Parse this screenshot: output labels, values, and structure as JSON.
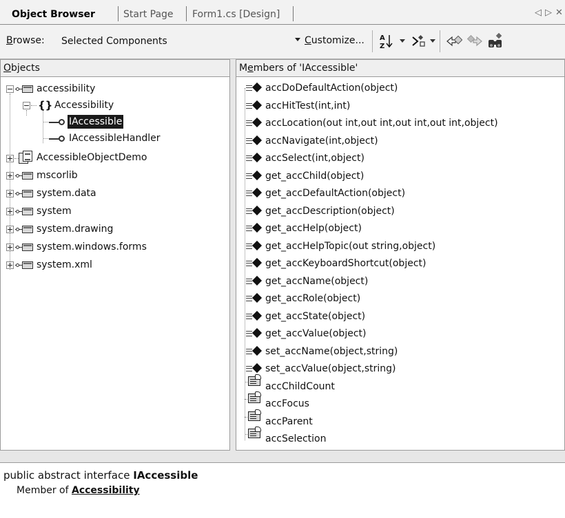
{
  "tabs": [
    {
      "label": "Object Browser",
      "active": true
    },
    {
      "label": "Start Page",
      "active": false
    },
    {
      "label": "Form1.cs [Design]",
      "active": false
    }
  ],
  "tab_nav": {
    "prev": "◁",
    "next": "▷",
    "close": "✕"
  },
  "toolbar": {
    "browse_label": "Browse:",
    "browse_value": "Selected Components",
    "customize_label": "Customize...",
    "buttons": [
      {
        "name": "sort-objects",
        "icon": "sort-az-icon"
      },
      {
        "name": "objects-pane-view",
        "icon": "members-filter-icon"
      },
      {
        "name": "back",
        "icon": "back-icon"
      },
      {
        "name": "forward",
        "icon": "forward-icon"
      },
      {
        "name": "find-symbol",
        "icon": "binoculars-icon"
      }
    ]
  },
  "objects_pane": {
    "header": "Objects",
    "tree": [
      {
        "label": "accessibility",
        "level": 0,
        "icon": "namespace-icon",
        "expander": "minus"
      },
      {
        "label": "Accessibility",
        "level": 1,
        "icon": "braces-icon",
        "expander": "minus"
      },
      {
        "label": "IAccessible",
        "level": 2,
        "icon": "interface-icon",
        "expander": "none",
        "selected": true
      },
      {
        "label": "IAccessibleHandler",
        "level": 2,
        "icon": "interface-icon",
        "expander": "none"
      },
      {
        "label": "AccessibleObjectDemo",
        "level": 0,
        "icon": "assembly-icon",
        "expander": "plus"
      },
      {
        "label": "mscorlib",
        "level": 0,
        "icon": "namespace-icon",
        "expander": "plus"
      },
      {
        "label": "system.data",
        "level": 0,
        "icon": "namespace-icon",
        "expander": "plus"
      },
      {
        "label": "system",
        "level": 0,
        "icon": "namespace-icon",
        "expander": "plus"
      },
      {
        "label": "system.drawing",
        "level": 0,
        "icon": "namespace-icon",
        "expander": "plus"
      },
      {
        "label": "system.windows.forms",
        "level": 0,
        "icon": "namespace-icon",
        "expander": "plus"
      },
      {
        "label": "system.xml",
        "level": 0,
        "icon": "namespace-icon",
        "expander": "plus"
      }
    ]
  },
  "members_pane": {
    "header": "Members of 'IAccessible'",
    "items": [
      {
        "label": "accDoDefaultAction(object)",
        "kind": "method"
      },
      {
        "label": "accHitTest(int,int)",
        "kind": "method"
      },
      {
        "label": "accLocation(out int,out int,out int,out int,object)",
        "kind": "method"
      },
      {
        "label": "accNavigate(int,object)",
        "kind": "method"
      },
      {
        "label": "accSelect(int,object)",
        "kind": "method"
      },
      {
        "label": "get_accChild(object)",
        "kind": "method"
      },
      {
        "label": "get_accDefaultAction(object)",
        "kind": "method"
      },
      {
        "label": "get_accDescription(object)",
        "kind": "method"
      },
      {
        "label": "get_accHelp(object)",
        "kind": "method"
      },
      {
        "label": "get_accHelpTopic(out string,object)",
        "kind": "method"
      },
      {
        "label": "get_accKeyboardShortcut(object)",
        "kind": "method"
      },
      {
        "label": "get_accName(object)",
        "kind": "method"
      },
      {
        "label": "get_accRole(object)",
        "kind": "method"
      },
      {
        "label": "get_accState(object)",
        "kind": "method"
      },
      {
        "label": "get_accValue(object)",
        "kind": "method"
      },
      {
        "label": "set_accName(object,string)",
        "kind": "method"
      },
      {
        "label": "set_accValue(object,string)",
        "kind": "method"
      },
      {
        "label": "accChildCount",
        "kind": "property"
      },
      {
        "label": "accFocus",
        "kind": "property"
      },
      {
        "label": "accParent",
        "kind": "property"
      },
      {
        "label": "accSelection",
        "kind": "property"
      }
    ]
  },
  "description": {
    "prefix": "public abstract interface ",
    "name": "IAccessible",
    "member_of_label": "Member of ",
    "member_of_link": "Accessibility"
  }
}
